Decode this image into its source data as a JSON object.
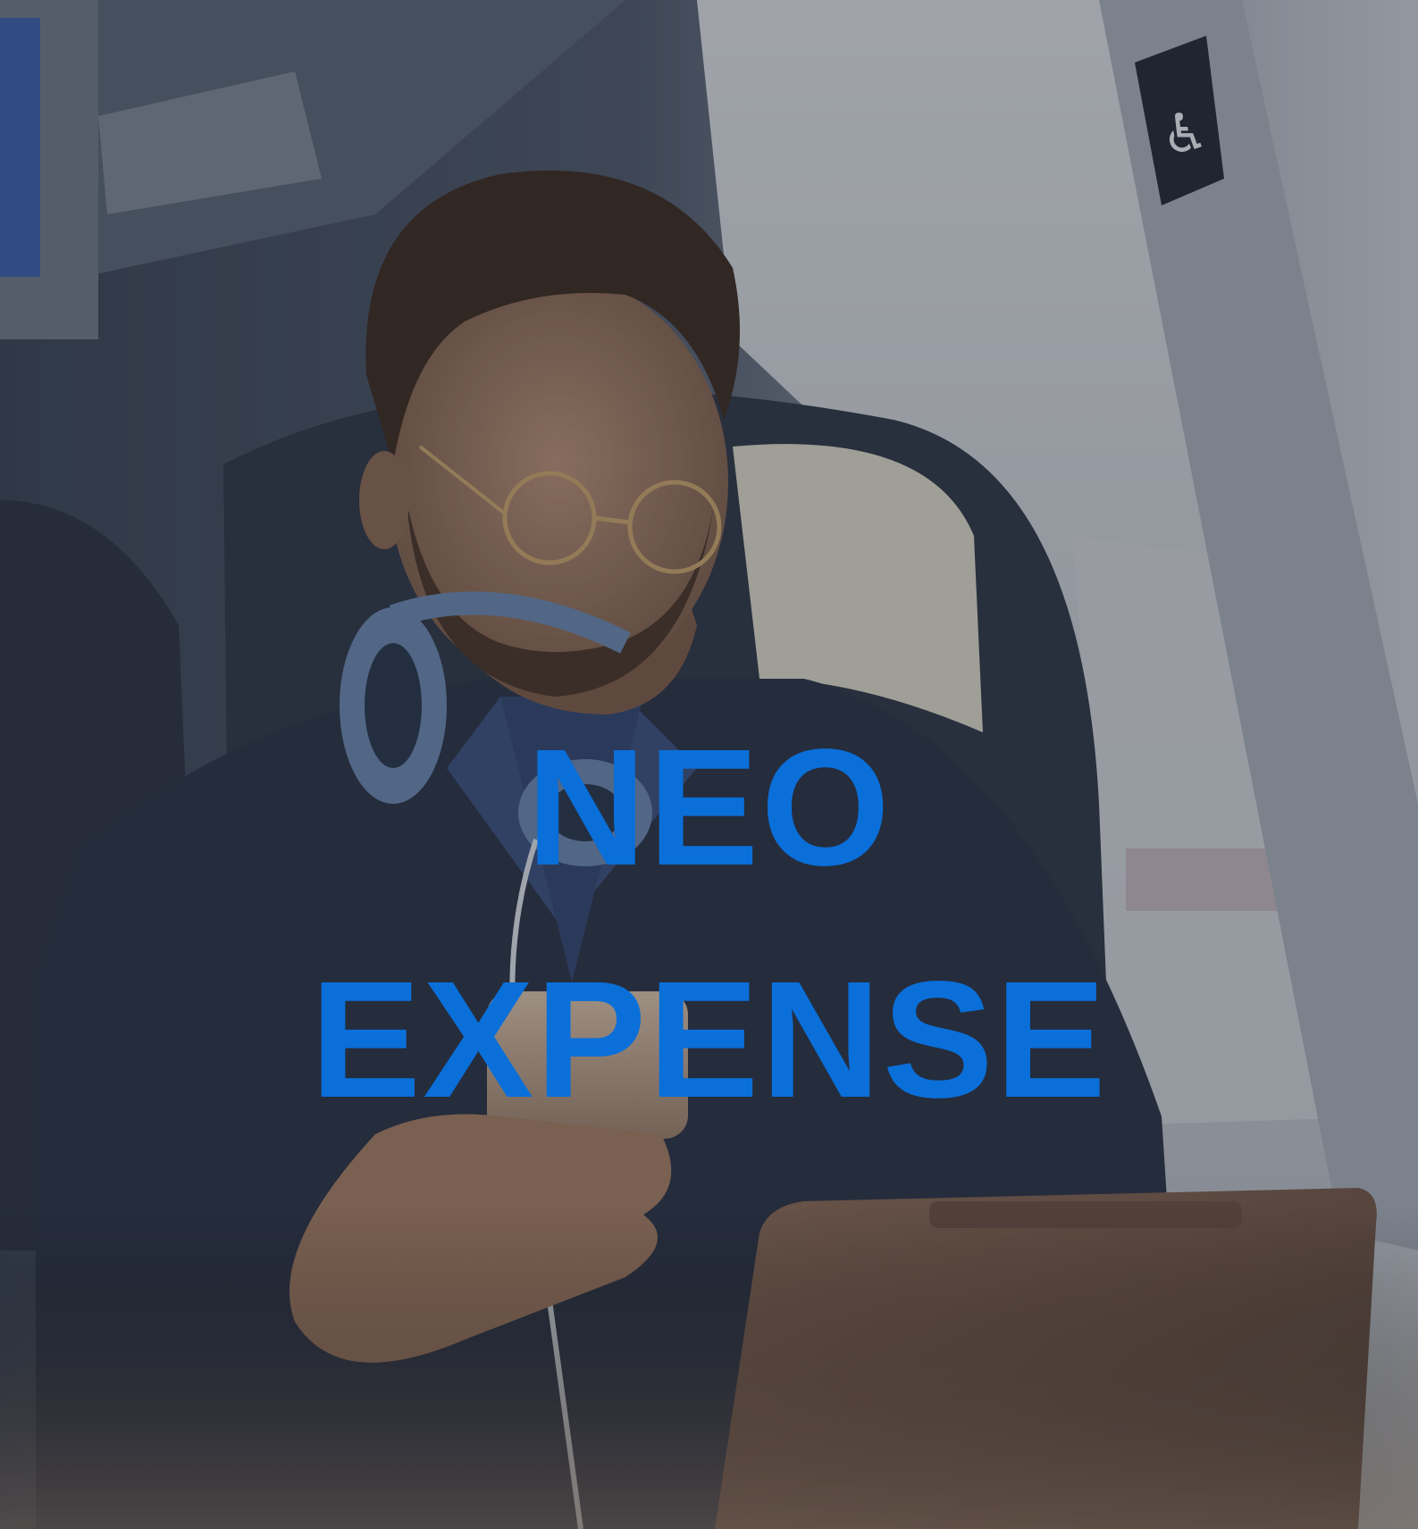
{
  "hero": {
    "headline_line1": "NEO",
    "headline_line2": "EXPENSE"
  },
  "colors": {
    "headline": "#0a6fd9",
    "overlay": "#1b2130"
  },
  "scene": "man-with-headphones-using-phone-on-train"
}
